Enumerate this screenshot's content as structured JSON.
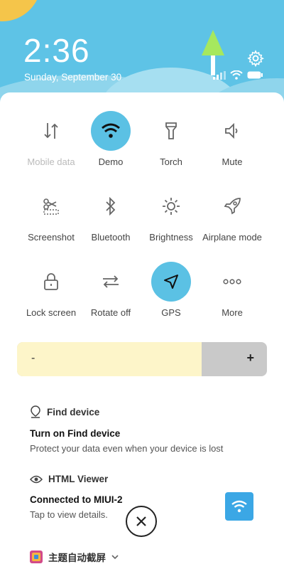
{
  "status": {
    "time": "2:36",
    "date": "Sunday, September 30"
  },
  "tiles": [
    {
      "label": "Mobile data",
      "icon": "mobile-data-icon",
      "active": false
    },
    {
      "label": "Demo",
      "icon": "wifi-icon",
      "active": true
    },
    {
      "label": "Torch",
      "icon": "torch-icon",
      "active": false
    },
    {
      "label": "Mute",
      "icon": "mute-icon",
      "active": false
    },
    {
      "label": "Screenshot",
      "icon": "screenshot-icon",
      "active": false
    },
    {
      "label": "Bluetooth",
      "icon": "bluetooth-icon",
      "active": false
    },
    {
      "label": "Brightness",
      "icon": "brightness-icon",
      "active": false
    },
    {
      "label": "Airplane mode",
      "icon": "airplane-icon",
      "active": false
    },
    {
      "label": "Lock screen",
      "icon": "lock-icon",
      "active": false
    },
    {
      "label": "Rotate off",
      "icon": "rotate-icon",
      "active": false
    },
    {
      "label": "GPS",
      "icon": "gps-icon",
      "active": true
    },
    {
      "label": "More",
      "icon": "more-icon",
      "active": false
    }
  ],
  "brightness": {
    "minus": "-",
    "plus": "+",
    "level": 0.74
  },
  "notifications": {
    "find_device": {
      "app": "Find device",
      "title": "Turn on Find device",
      "text": "Protect your data even when your device is lost"
    },
    "html_viewer": {
      "app": "HTML Viewer",
      "title": "Connected to MIUI-2",
      "text": "Tap to view details."
    },
    "theme": {
      "app": "主题自动截屏"
    }
  },
  "colors": {
    "accent": "#5bc1e4",
    "header": "#5ec3e6"
  }
}
